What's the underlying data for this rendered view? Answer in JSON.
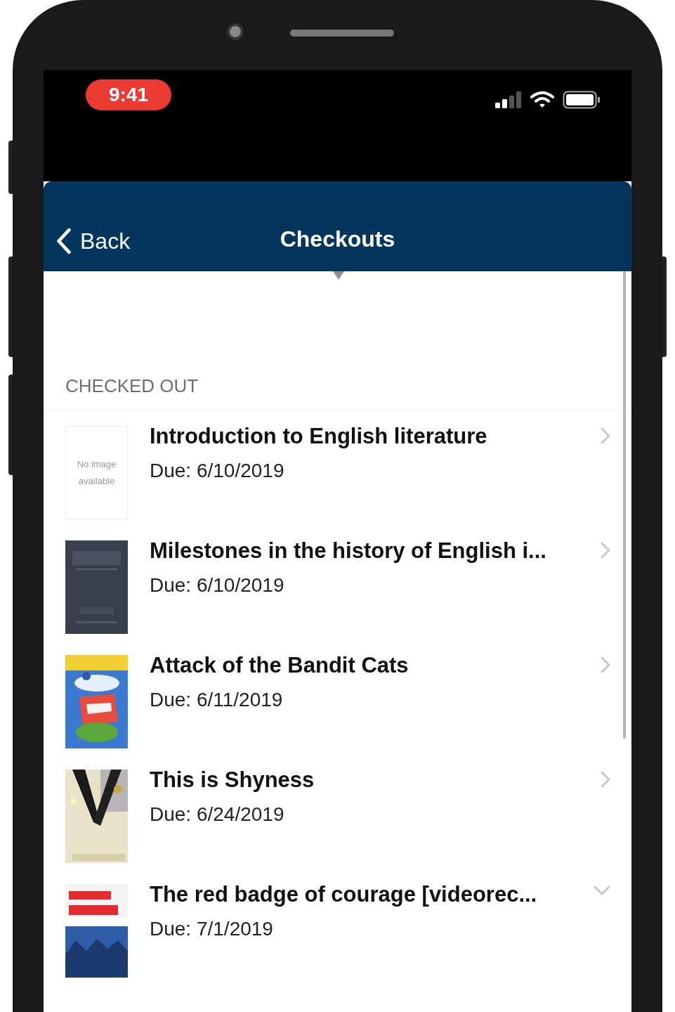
{
  "status_bar": {
    "time": "9:41"
  },
  "nav_bar": {
    "back": "Back",
    "title": "Checkouts"
  },
  "section": {
    "header": "CHECKED OUT",
    "items": [
      {
        "cover": {
          "kind": "placeholder",
          "text": "No image available"
        },
        "title": "Introduction to English literature",
        "due": "Due: 6/10/2019",
        "expanded": false
      },
      {
        "title": "Milestones in the history of English i...",
        "due": "Due: 6/10/2019",
        "expanded": false
      },
      {
        "title": "Attack of the Bandit Cats",
        "due": "Due: 6/11/2019",
        "expanded": false
      },
      {
        "title": "This is Shyness",
        "due": "Due: 6/24/2019",
        "expanded": false
      },
      {
        "title": "The red badge of courage [videorec...",
        "due": "Due: 7/1/2019",
        "expanded": true
      }
    ]
  }
}
